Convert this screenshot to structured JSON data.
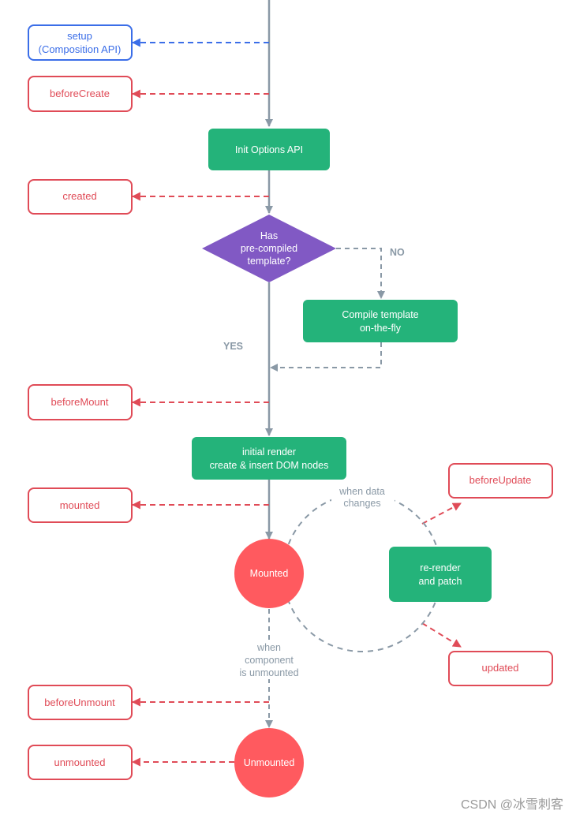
{
  "colors": {
    "hook_red": "#e04b57",
    "hook_blue": "#3b6ee8",
    "process_green": "#24b37a",
    "decision_purple": "#8159c4",
    "state_red": "#ff5a5f",
    "flow_gray": "#8a99a6"
  },
  "hooks": {
    "setup": [
      "setup",
      "(Composition API)"
    ],
    "beforeCreate": "beforeCreate",
    "created": "created",
    "beforeMount": "beforeMount",
    "mounted": "mounted",
    "beforeUpdate": "beforeUpdate",
    "updated": "updated",
    "beforeUnmount": "beforeUnmount",
    "unmounted": "unmounted"
  },
  "nodes": {
    "init_options": "Init Options API",
    "decision": [
      "Has",
      "pre-compiled",
      "template?"
    ],
    "compile": [
      "Compile template",
      "on-the-fly"
    ],
    "initial_render": [
      "initial render",
      "create & insert DOM nodes"
    ],
    "rerender": [
      "re-render",
      "and patch"
    ],
    "mounted_state": "Mounted",
    "unmounted_state": "Unmounted"
  },
  "labels": {
    "no": "NO",
    "yes": "YES",
    "when_data_changes": [
      "when data",
      "changes"
    ],
    "when_unmounted": [
      "when",
      "component",
      "is unmounted"
    ]
  },
  "watermark": "CSDN @冰雪刺客"
}
